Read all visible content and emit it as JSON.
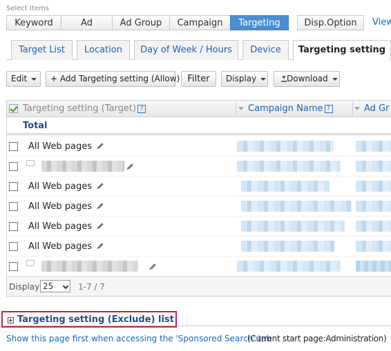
{
  "select_items_label": "Select Items",
  "select_tabs": [
    {
      "label": "Keyword",
      "active": false
    },
    {
      "label": "Ad",
      "active": false
    },
    {
      "label": "Ad Group",
      "active": false
    },
    {
      "label": "Campaign",
      "active": false
    },
    {
      "label": "Targeting",
      "active": true
    },
    {
      "label": "Disp.Option",
      "active": false
    }
  ],
  "view_link": "View",
  "sub_tabs": [
    {
      "label": "Target List",
      "active": false
    },
    {
      "label": "Location",
      "active": false
    },
    {
      "label": "Day of Week / Hours",
      "active": false
    },
    {
      "label": "Device",
      "active": false
    },
    {
      "label": "Targeting setting",
      "active": true
    }
  ],
  "toolbar": {
    "edit": "Edit",
    "add": "Add Targeting setting (Allow)",
    "filter": "Filter",
    "display": "Display",
    "download": "Download"
  },
  "table": {
    "columns": [
      "Targeting setting (Target)",
      "Campaign Name",
      "Ad Gr"
    ],
    "help_mark": "?",
    "total_label": "Total",
    "rows": [
      {
        "target": "All Web pages",
        "redacted": false
      },
      {
        "target": "",
        "redacted": true
      },
      {
        "target": "All Web pages",
        "redacted": false
      },
      {
        "target": "All Web pages",
        "redacted": false
      },
      {
        "target": "All Web pages",
        "redacted": false
      },
      {
        "target": "All Web pages",
        "redacted": false
      },
      {
        "target": "",
        "redacted": true
      }
    ]
  },
  "pager": {
    "display_label": "Display",
    "per_page": "25",
    "range": "1-7 / 7"
  },
  "exclude_list_label": "Targeting setting (Exclude) list",
  "footer": {
    "link": "Show this page first when accessing the 'Sponsored Search' tab",
    "note": "(Current start page:Administration)"
  },
  "colors": {
    "active_tab": "#4a8fd4",
    "link": "#1a66b5",
    "highlight_border": "#c0253f"
  }
}
